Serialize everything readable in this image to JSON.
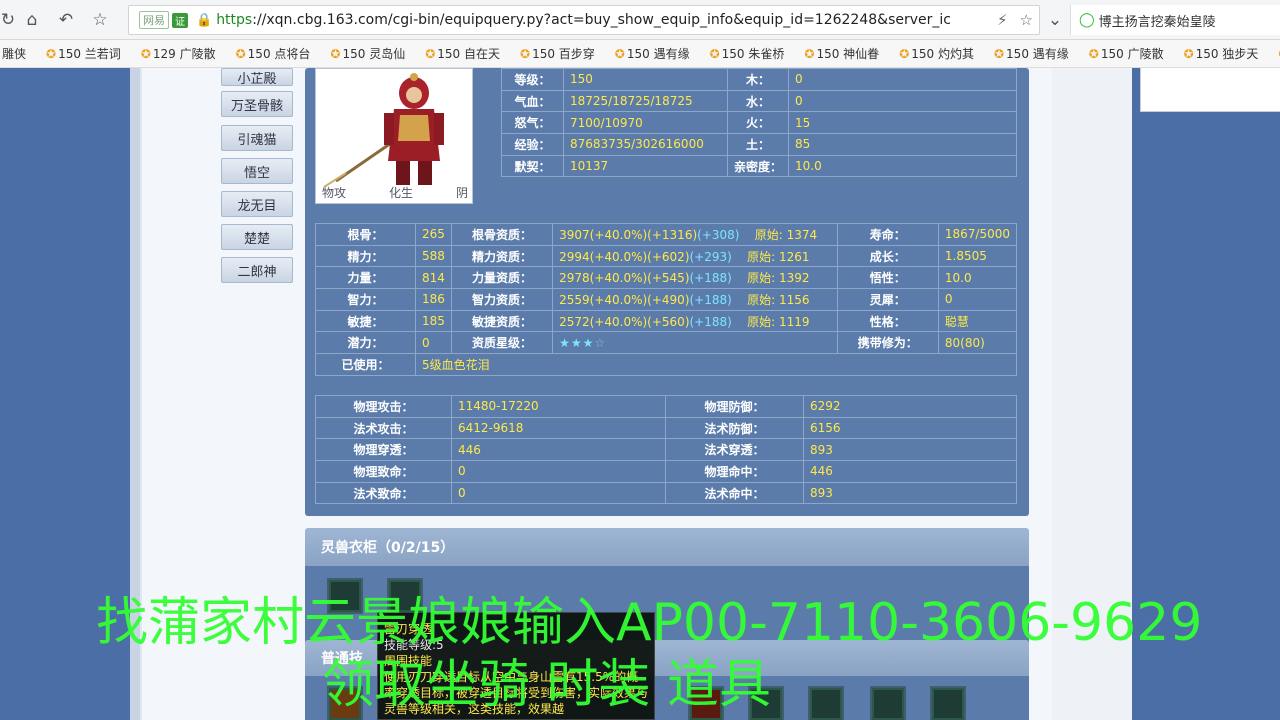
{
  "browser": {
    "badge1": "网易",
    "badge2": "证",
    "url_https": "https",
    "url_rest": "://xqn.cbg.163.com/cgi-bin/equipquery.py?act=buy_show_equip_info&equip_id=1262248&server_ic",
    "search_text": "博主扬言挖秦始皇陵"
  },
  "bookmarks": [
    "雕侠",
    "150 兰若词",
    "129 广陵散",
    "150 点将台",
    "150 灵岛仙",
    "150 自在天",
    "150 百步穿",
    "150 遇有缘",
    "150 朱雀桥",
    "150 神仙眷",
    "150 灼灼其",
    "150 遇有缘",
    "150 广陵散",
    "150 独步天",
    "150"
  ],
  "side_buttons": [
    "小芷殿",
    "万圣骨骸",
    "引魂猫",
    "悟空",
    "龙无目",
    "楚楚",
    "二郎神"
  ],
  "pet": {
    "tag1": "物攻",
    "tag2": "化生",
    "tag3": "阴"
  },
  "info": [
    [
      "等级：",
      "150",
      "木：",
      "0"
    ],
    [
      "气血：",
      "18725/18725/18725",
      "水：",
      "0"
    ],
    [
      "怒气：",
      "7100/10970",
      "火：",
      "15"
    ],
    [
      "经验：",
      "87683735/302616000",
      "土：",
      "85"
    ],
    [
      "默契：",
      "10137",
      "亲密度：",
      "10.0"
    ]
  ],
  "attrs": [
    {
      "l1": "根骨：",
      "v1": "265",
      "l2": "根骨资质：",
      "base": "3907",
      "pct": "(+40.0%)",
      "p1": "(+1316)",
      "p2": "(+308)",
      "orig": "原始: 1374",
      "l3": "寿命：",
      "v3": "1867/5000"
    },
    {
      "l1": "精力：",
      "v1": "588",
      "l2": "精力资质：",
      "base": "2994",
      "pct": "(+40.0%)",
      "p1": "(+602)",
      "p2": "(+293)",
      "orig": "原始: 1261",
      "l3": "成长：",
      "v3": "1.8505"
    },
    {
      "l1": "力量：",
      "v1": "814",
      "l2": "力量资质：",
      "base": "2978",
      "pct": "(+40.0%)",
      "p1": "(+545)",
      "p2": "(+188)",
      "orig": "原始: 1392",
      "l3": "悟性：",
      "v3": "10.0"
    },
    {
      "l1": "智力：",
      "v1": "186",
      "l2": "智力资质：",
      "base": "2559",
      "pct": "(+40.0%)",
      "p1": "(+490)",
      "p2": "(+188)",
      "orig": "原始: 1156",
      "l3": "灵犀：",
      "v3": "0"
    },
    {
      "l1": "敏捷：",
      "v1": "185",
      "l2": "敏捷资质：",
      "base": "2572",
      "pct": "(+40.0%)",
      "p1": "(+560)",
      "p2": "(+188)",
      "orig": "原始: 1119",
      "l3": "性格：",
      "v3": "聪慧"
    }
  ],
  "potential": {
    "label": "潜力：",
    "value": "0",
    "star_label": "资质星级：",
    "stars_on": "★★★",
    "stars_off": "☆",
    "carry_label": "携带修为：",
    "carry_value": "80(80)"
  },
  "used": {
    "label": "已使用：",
    "value": "5级血色花泪"
  },
  "combat": [
    [
      "物理攻击：",
      "11480-17220",
      "物理防御：",
      "6292"
    ],
    [
      "法术攻击：",
      "6412-9618",
      "法术防御：",
      "6156"
    ],
    [
      "物理穿透：",
      "446",
      "法术穿透：",
      "893"
    ],
    [
      "物理致命：",
      "0",
      "物理命中：",
      "446"
    ],
    [
      "法术致命：",
      "0",
      "法术命中：",
      "893"
    ]
  ],
  "wardrobe": {
    "title": "灵兽衣柜（0/2/15）"
  },
  "skills": {
    "title": "普通技"
  },
  "tooltip": {
    "title": "雷刃穿透",
    "level": "技能等级:5",
    "type": "周围技能",
    "desc": "使用刃刀穿透目标从空中与身山雷有15.5%的概率穿透目标，被穿透目标将受到伤害，实际效果与灵兽等级相关，这类技能，效果越"
  },
  "overlay": {
    "line1": "找蒲家村云景娘娘输入AP00-7110-3606-9629",
    "line2": "领取坐骑 时装 道具"
  }
}
